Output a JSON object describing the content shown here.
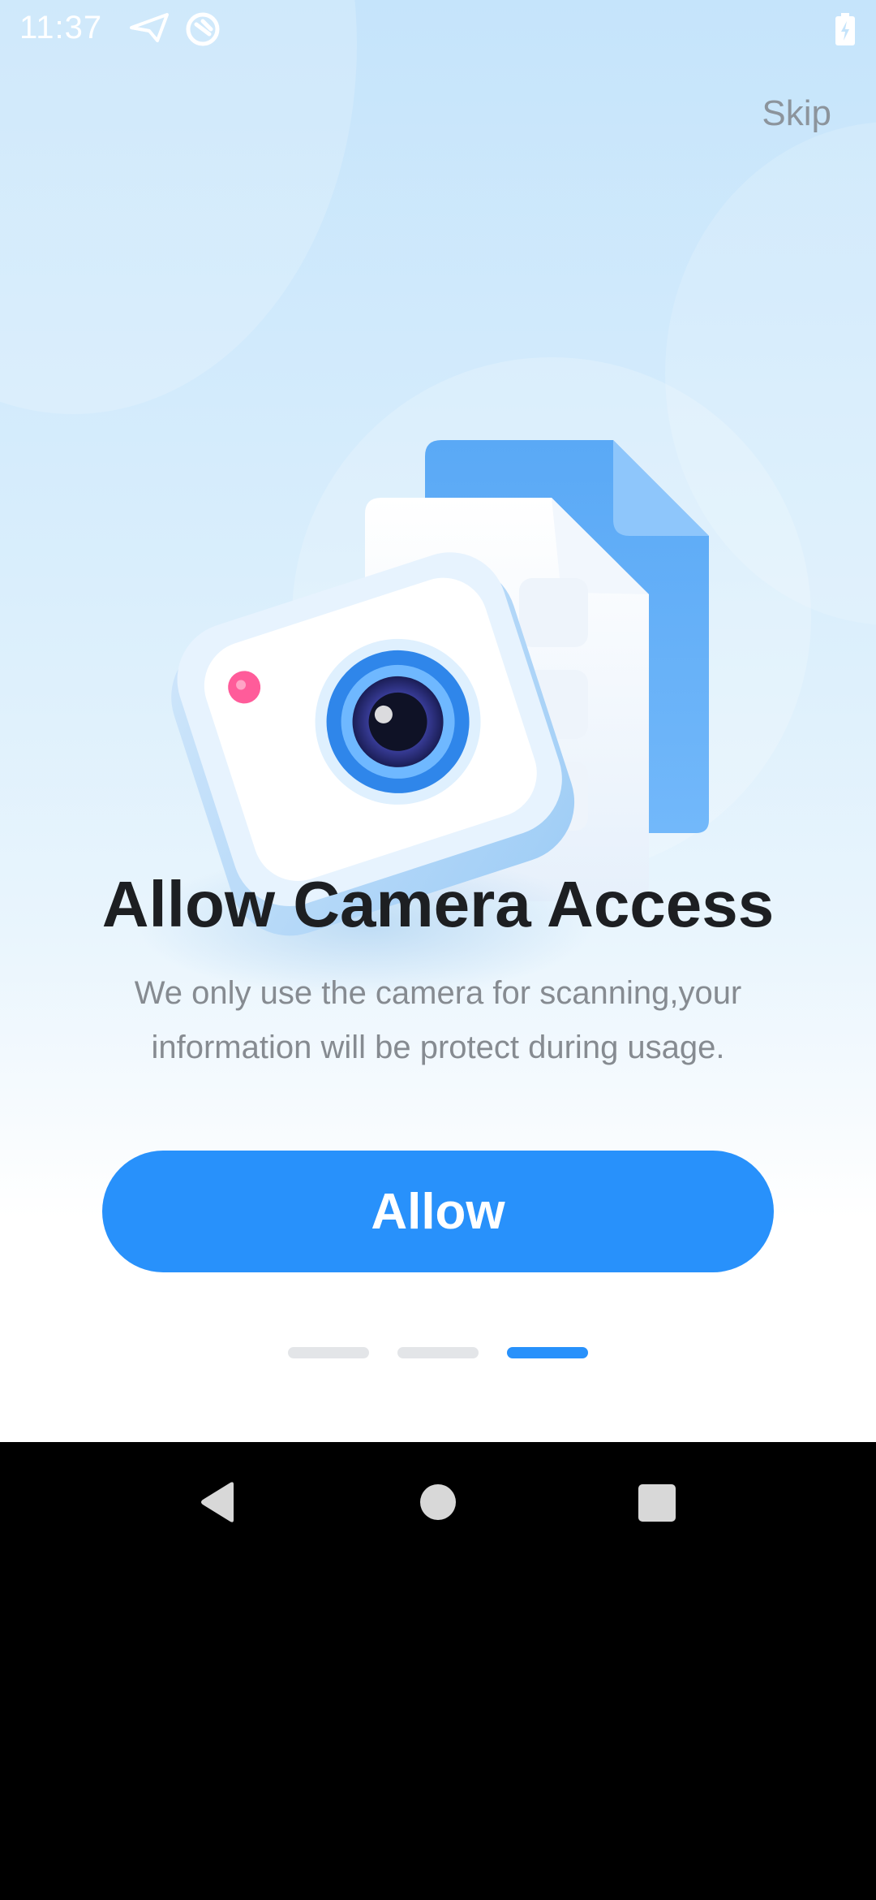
{
  "status_bar": {
    "time": "11:37",
    "icons": [
      "send-icon",
      "sync-icon",
      "battery-charging-icon"
    ]
  },
  "skip_label": "Skip",
  "title": "Allow Camera Access",
  "description_lines": [
    "We only use the camera for scanning,your",
    "information will be protect during usage."
  ],
  "allow_label": "Allow",
  "page_indicator": {
    "total": 3,
    "active": 3
  },
  "nav_bar": {
    "icons": [
      "back-icon",
      "home-icon",
      "recents-icon"
    ]
  },
  "colors": {
    "accent": "#2891fb",
    "title": "#1d1f22",
    "description": "#868b91",
    "skip": "#8c949c",
    "background_top": "#c5e4fb",
    "background_bottom": "#ffffff",
    "indicator_inactive": "#e3e5e8"
  }
}
